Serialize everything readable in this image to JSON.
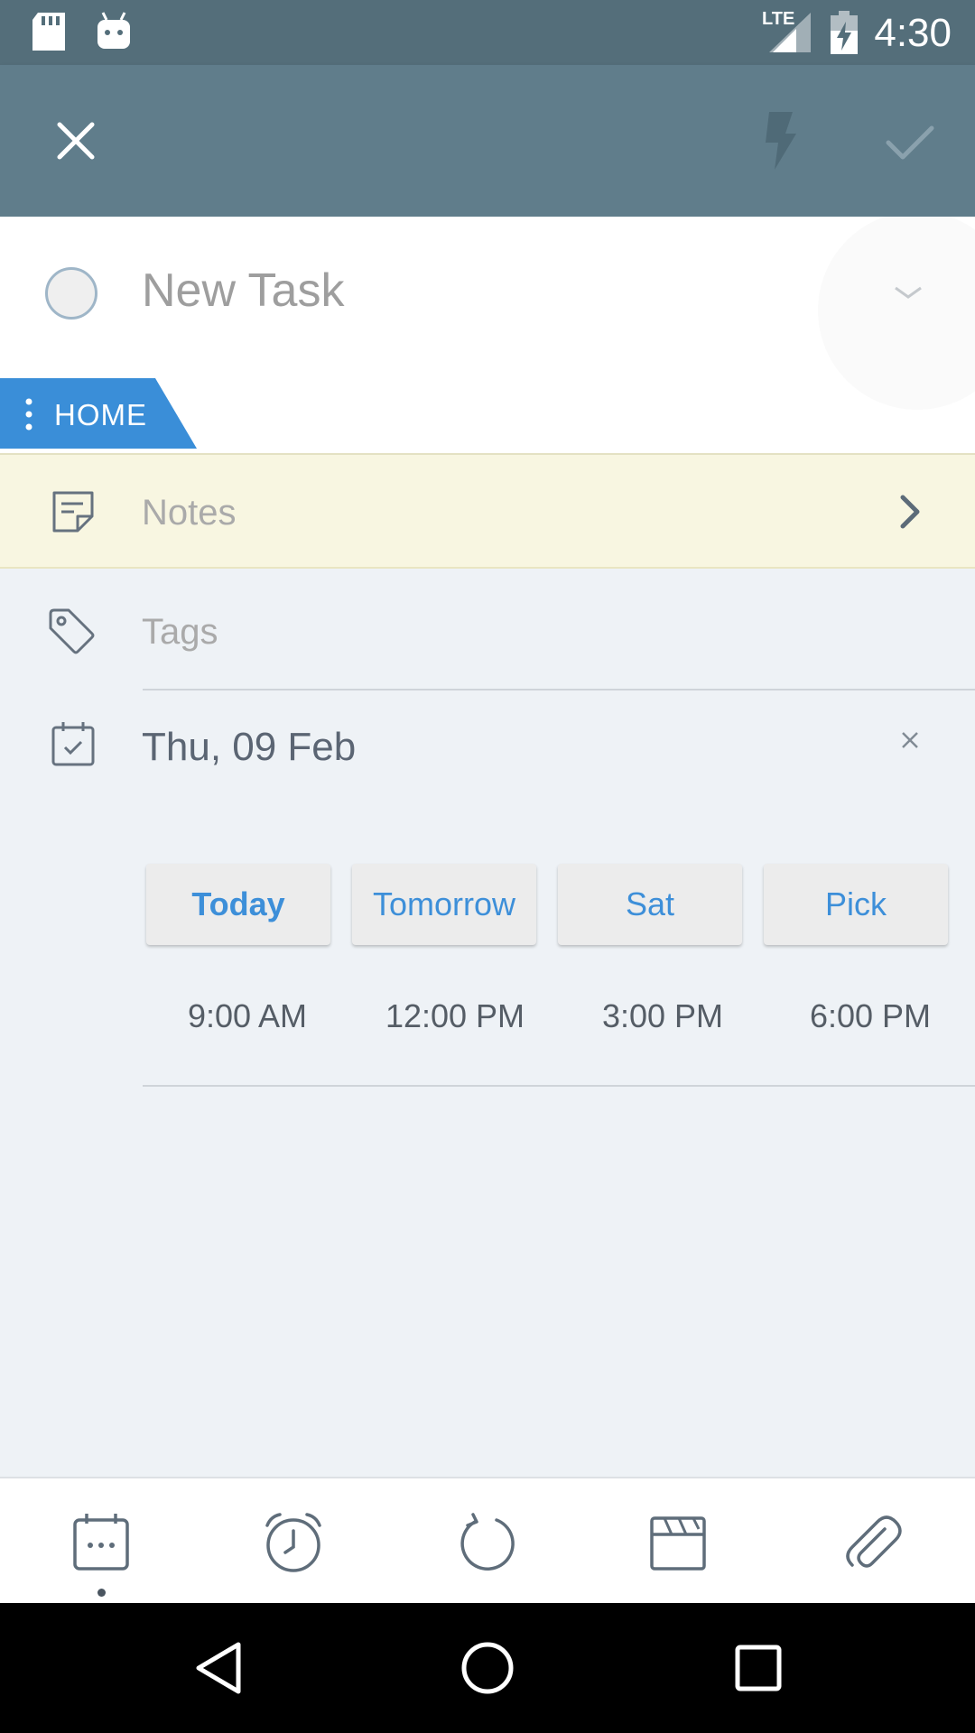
{
  "status_bar": {
    "time": "4:30",
    "network": "LTE",
    "icons": [
      "sd-card-icon",
      "android-icon",
      "lte-signal-icon",
      "battery-charging-icon"
    ]
  },
  "app_bar": {
    "icons": [
      "close-icon",
      "flash-icon",
      "checkmark-icon"
    ]
  },
  "task": {
    "title_placeholder": "New Task",
    "list_tag": "HOME"
  },
  "notes": {
    "placeholder": "Notes"
  },
  "tags": {
    "placeholder": "Tags"
  },
  "due": {
    "date": "Thu, 09 Feb",
    "quick_dates": [
      "Today",
      "Tomorrow",
      "Sat",
      "Pick"
    ],
    "quick_times": [
      "9:00 AM",
      "12:00 PM",
      "3:00 PM",
      "6:00 PM"
    ]
  },
  "toolbar": {
    "icons": [
      "calendar-icon",
      "alarm-icon",
      "repeat-icon",
      "project-icon",
      "attachment-icon"
    ],
    "selected": "calendar-icon"
  },
  "colors": {
    "status_bar": "#546e7a",
    "app_bar": "#607d8b",
    "accent_blue": "#3d8fd9",
    "notes_bg": "#f8f6e1",
    "page_bg": "#eef2f6"
  }
}
